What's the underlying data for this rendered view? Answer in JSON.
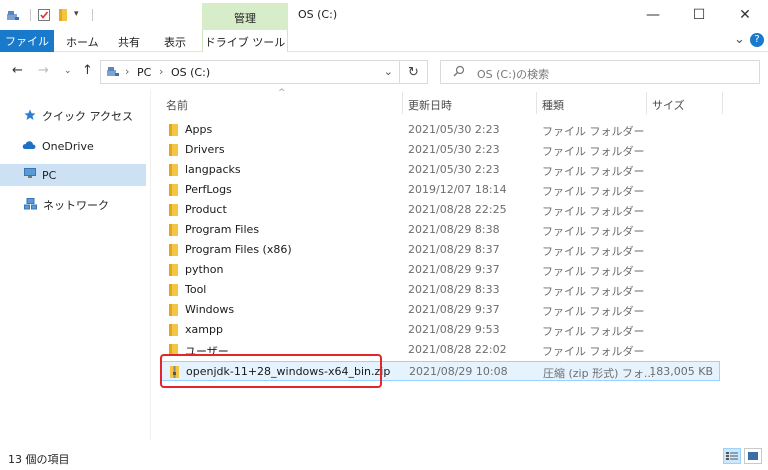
{
  "window": {
    "title": "OS (C:)",
    "context_tab_group": "管理",
    "minimize": "—",
    "maximize": "☐",
    "close": "✕"
  },
  "ribbon": {
    "file_tab": "ファイル",
    "tabs": [
      "ホーム",
      "共有",
      "表示"
    ],
    "context_tab": "ドライブ ツール",
    "expand": "⌄",
    "help": "?"
  },
  "address": {
    "crumbs": [
      "PC",
      "OS (C:)"
    ],
    "separator": "›",
    "search_placeholder": "OS (C:)の検索"
  },
  "nav": {
    "items": [
      {
        "label": "クイック アクセス",
        "icon": "quick-access-star-icon"
      },
      {
        "label": "OneDrive",
        "icon": "onedrive-cloud-icon"
      },
      {
        "label": "PC",
        "icon": "pc-icon"
      },
      {
        "label": "ネットワーク",
        "icon": "network-icon"
      }
    ]
  },
  "columns": {
    "name": "名前",
    "date": "更新日時",
    "type": "種類",
    "size": "サイズ"
  },
  "files": [
    {
      "name": "Apps",
      "date": "2021/05/30 2:23",
      "type": "ファイル フォルダー",
      "size": ""
    },
    {
      "name": "Drivers",
      "date": "2021/05/30 2:23",
      "type": "ファイル フォルダー",
      "size": ""
    },
    {
      "name": "langpacks",
      "date": "2021/05/30 2:23",
      "type": "ファイル フォルダー",
      "size": ""
    },
    {
      "name": "PerfLogs",
      "date": "2019/12/07 18:14",
      "type": "ファイル フォルダー",
      "size": ""
    },
    {
      "name": "Product",
      "date": "2021/08/28 22:25",
      "type": "ファイル フォルダー",
      "size": ""
    },
    {
      "name": "Program Files",
      "date": "2021/08/29 8:38",
      "type": "ファイル フォルダー",
      "size": ""
    },
    {
      "name": "Program Files (x86)",
      "date": "2021/08/29 8:37",
      "type": "ファイル フォルダー",
      "size": ""
    },
    {
      "name": "python",
      "date": "2021/08/29 9:37",
      "type": "ファイル フォルダー",
      "size": ""
    },
    {
      "name": "Tool",
      "date": "2021/08/29 8:33",
      "type": "ファイル フォルダー",
      "size": ""
    },
    {
      "name": "Windows",
      "date": "2021/08/29 9:37",
      "type": "ファイル フォルダー",
      "size": ""
    },
    {
      "name": "xampp",
      "date": "2021/08/29 9:53",
      "type": "ファイル フォルダー",
      "size": ""
    },
    {
      "name": "ユーザー",
      "date": "2021/08/28 22:02",
      "type": "ファイル フォルダー",
      "size": ""
    },
    {
      "name": "openjdk-11+28_windows-x64_bin.zip",
      "date": "2021/08/29 10:08",
      "type": "圧縮 (zip 形式) フォ...",
      "size": "183,005 KB"
    }
  ],
  "status": {
    "item_count": "13 個の項目"
  },
  "colors": {
    "accent": "#1979ca",
    "context_tab": "#d7ecc9",
    "folder": "#f4c542",
    "highlight": "#e3262b",
    "selection": "#cde1f5"
  }
}
